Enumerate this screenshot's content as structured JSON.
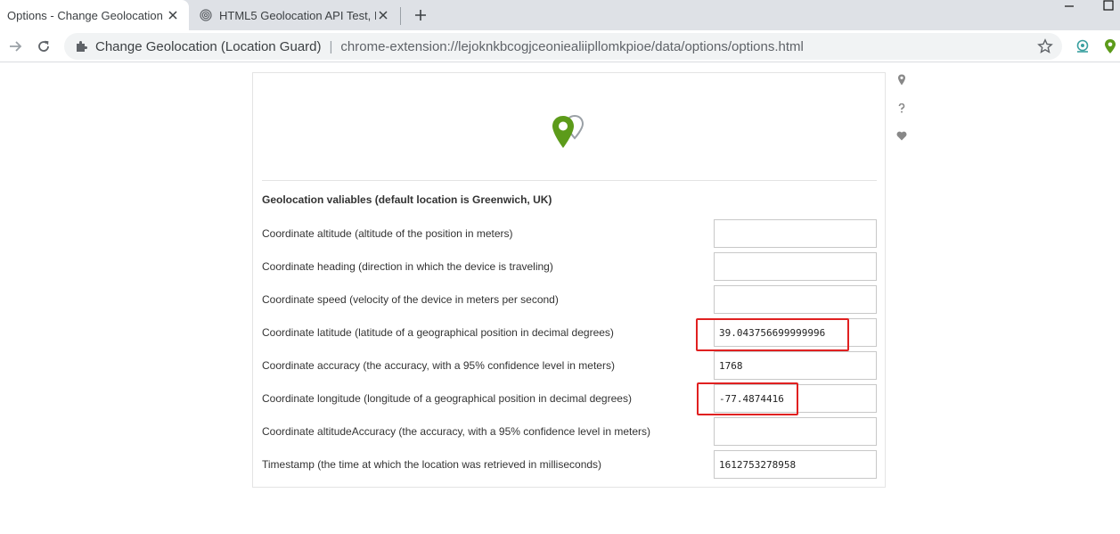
{
  "browser": {
    "tabs": [
      {
        "title": "Options - Change Geolocation",
        "active": true
      },
      {
        "title": "HTML5 Geolocation API Test, I",
        "active": false
      }
    ],
    "omnibox": {
      "site_name": "Change Geolocation (Location Guard)",
      "separator": "|",
      "url": "chrome-extension://lejoknkbcogjceoniealiipllomkpioe/data/options/options.html"
    }
  },
  "colors": {
    "brand_green": "#5c9b1a",
    "highlight_red": "#e02020"
  },
  "options": {
    "heading": "Geolocation valiables (default location is Greenwich, UK)",
    "fields": [
      {
        "label": "Coordinate altitude (altitude of the position in meters)",
        "value": ""
      },
      {
        "label": "Coordinate heading (direction in which the device is traveling)",
        "value": ""
      },
      {
        "label": "Coordinate speed (velocity of the device in meters per second)",
        "value": ""
      },
      {
        "label": "Coordinate latitude (latitude of a geographical position in decimal degrees)",
        "value": "39.043756699999996"
      },
      {
        "label": "Coordinate accuracy (the accuracy, with a 95% confidence level in meters)",
        "value": "1768"
      },
      {
        "label": "Coordinate longitude (longitude of a geographical position in decimal degrees)",
        "value": "-77.4874416"
      },
      {
        "label": "Coordinate altitudeAccuracy (the accuracy, with a 95% confidence level in meters)",
        "value": ""
      },
      {
        "label": "Timestamp (the time at which the location was retrieved in milliseconds)",
        "value": "1612753278958"
      }
    ]
  },
  "side_icons": [
    "location-pin-icon",
    "question-icon",
    "heart-icon"
  ]
}
